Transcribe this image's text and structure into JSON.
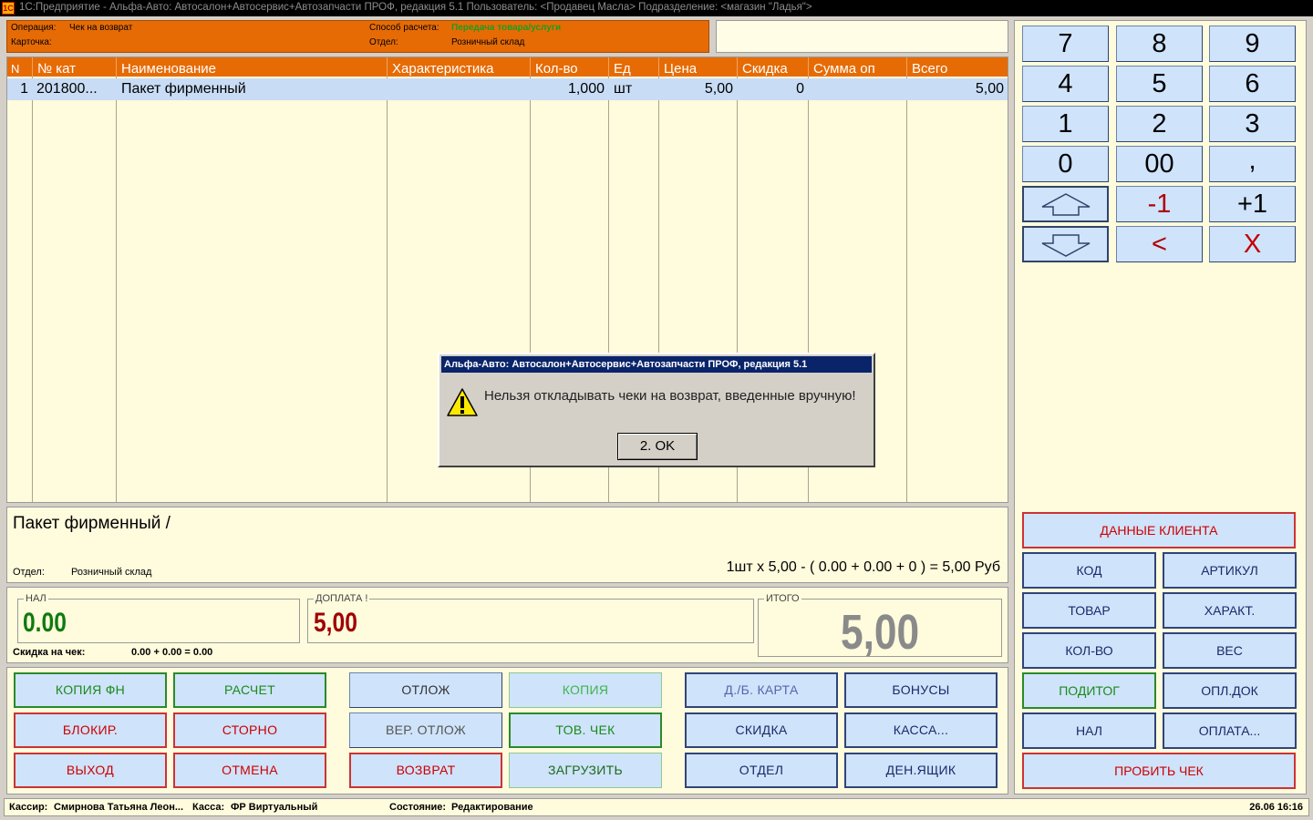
{
  "window": {
    "title": "1С:Предприятие - Альфа-Авто: Автосалон+Автосервис+Автозапчасти ПРОФ, редакция 5.1    Пользователь: <Продавец Масла>    Подразделение: <магазин \"Ладья\">",
    "icon_text": "1С"
  },
  "info": {
    "operation_label": "Операция:",
    "operation_value": "Чек на возврат",
    "card_label": "Карточка:",
    "payment_label": "Способ расчета:",
    "payment_value": "Передача товара/услуги",
    "dept_label": "Отдел:",
    "dept_value": "Розничный склад"
  },
  "table": {
    "headers": [
      "N",
      "№ кат",
      "Наименование",
      "Характеристика",
      "Кол-во",
      "Ед",
      "Цена",
      "Скидка",
      "Сумма оп",
      "Всего"
    ],
    "rows": [
      {
        "n": "1",
        "cat": "201800...",
        "name": "Пакет фирменный",
        "char": "",
        "qty": "1,000",
        "unit": "шт",
        "price": "5,00",
        "discount": "0",
        "sum_op": "",
        "total": "5,00"
      }
    ]
  },
  "item": {
    "name": "Пакет фирменный /",
    "dept_label": "Отдел:",
    "dept_value": "Розничный склад",
    "formula": "1шт x 5,00 - ( 0.00 + 0.00 + 0 ) = 5,00 Руб"
  },
  "totals": {
    "cash_label": "НАЛ",
    "cash_value": "0.00",
    "extra_label": "ДОПЛАТА !",
    "extra_value": "5,00",
    "total_label": "ИТОГО",
    "total_value": "5,00",
    "discount_label": "Скидка на чек:",
    "discount_value": "0.00 + 0.00 = 0.00"
  },
  "buttons": {
    "copy_fn": "КОПИЯ ФН",
    "calc": "РАСЧЕТ",
    "postpone": "ОТЛОЖ",
    "copy": "КОПИЯ",
    "card": "Д./Б. КАРТА",
    "bonus": "БОНУСЫ",
    "block": "БЛОКИР.",
    "storno": "СТОРНО",
    "return_postponed": "ВЕР. ОТЛОЖ",
    "goods_check": "ТОВ. ЧЕК",
    "discount": "СКИДКА",
    "cashbox": "КАССА...",
    "exit": "ВЫХОД",
    "cancel": "ОТМЕНА",
    "refund": "ВОЗВРАТ",
    "load": "ЗАГРУЗИТЬ",
    "dept": "ОТДЕЛ",
    "drawer": "ДЕН.ЯЩИК"
  },
  "keypad": {
    "k7": "7",
    "k8": "8",
    "k9": "9",
    "k4": "4",
    "k5": "5",
    "k6": "6",
    "k1": "1",
    "k2": "2",
    "k3": "3",
    "k0": "0",
    "k00": "00",
    "comma": ",",
    "minus1": "-1",
    "plus1": "+1",
    "back": "<",
    "clear": "X"
  },
  "right_buttons": {
    "client_data": "ДАННЫЕ КЛИЕНТА",
    "code": "КОД",
    "article": "АРТИКУЛ",
    "goods": "ТОВАР",
    "charact": "ХАРАКТ.",
    "qty": "КОЛ-ВО",
    "weight": "ВЕС",
    "subtotal": "ПОДИТОГ",
    "pay_doc": "ОПЛ.ДОК",
    "cash": "НАЛ",
    "payment": "ОПЛАТА...",
    "print_check": "ПРОБИТЬ ЧЕК"
  },
  "status": {
    "cashier_label": "Кассир:",
    "cashier_value": "Смирнова Татьяна Леон...",
    "till_label": "Касса:",
    "till_value": "ФР Виртуальный",
    "state_label": "Состояние:",
    "state_value": "Редактирование",
    "datetime": "26.06 16:16"
  },
  "dialog": {
    "title": "Альфа-Авто: Автосалон+Автосервис+Автозапчасти ПРОФ, редакция 5.1",
    "message": "Нельзя откладывать чеки на возврат, введенные вручную!",
    "ok_label": "2. OK",
    "icon": "warning-icon"
  },
  "colors": {
    "header_orange": "#e66b05",
    "panel_bg": "#fffbdd",
    "button_bg": "#cfe3fb",
    "cash_green": "#107a10",
    "extra_red": "#a00000",
    "total_gray": "#8a8a8a"
  }
}
